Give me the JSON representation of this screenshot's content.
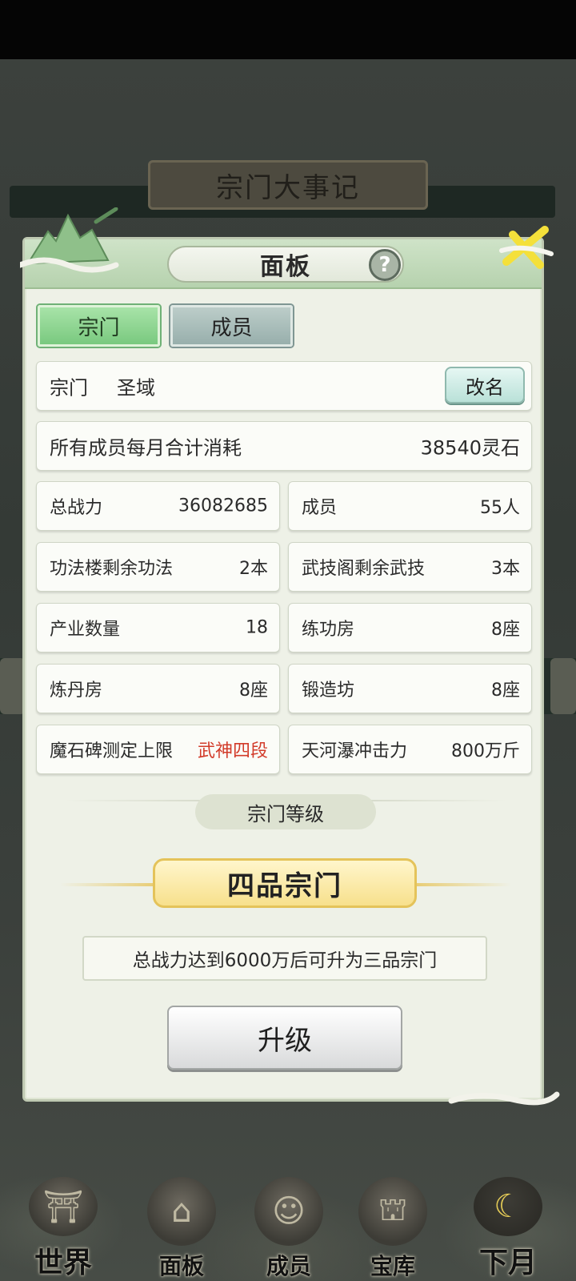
{
  "background": {
    "banner_title": "宗门大事记"
  },
  "panel": {
    "title": "面板",
    "help_symbol": "?",
    "tabs": [
      {
        "label": "宗门",
        "active": true
      },
      {
        "label": "成员",
        "active": false
      }
    ],
    "sect": {
      "label": "宗门",
      "name": "圣域",
      "rename_label": "改名"
    },
    "monthly": {
      "label": "所有成员每月合计消耗",
      "value": "38540灵石"
    },
    "stats": [
      {
        "label": "总战力",
        "value": "36082685"
      },
      {
        "label": "成员",
        "value": "55人"
      },
      {
        "label": "功法楼剩余功法",
        "value": "2本"
      },
      {
        "label": "武技阁剩余武技",
        "value": "3本"
      },
      {
        "label": "产业数量",
        "value": "18"
      },
      {
        "label": "练功房",
        "value": "8座"
      },
      {
        "label": "炼丹房",
        "value": "8座"
      },
      {
        "label": "锻造坊",
        "value": "8座"
      },
      {
        "label": "魔石碑测定上限",
        "value": "武神四段",
        "highlight": true
      },
      {
        "label": "天河瀑冲击力",
        "value": "800万斤"
      }
    ],
    "level_section_label": "宗门等级",
    "current_rank": "四品宗门",
    "upgrade_hint": "总战力达到6000万后可升为三品宗门",
    "upgrade_label": "升级"
  },
  "nav": [
    {
      "label": "世界",
      "icon": "palace-icon"
    },
    {
      "label": "面板",
      "icon": "hall-icon"
    },
    {
      "label": "成员",
      "icon": "person-icon"
    },
    {
      "label": "宝库",
      "icon": "treasury-icon"
    },
    {
      "label": "下月",
      "icon": "moon-icon"
    }
  ],
  "colors": {
    "highlight_red": "#d23b2a",
    "tab_active": "#79c97f",
    "rank_gold": "#f7e08c"
  }
}
